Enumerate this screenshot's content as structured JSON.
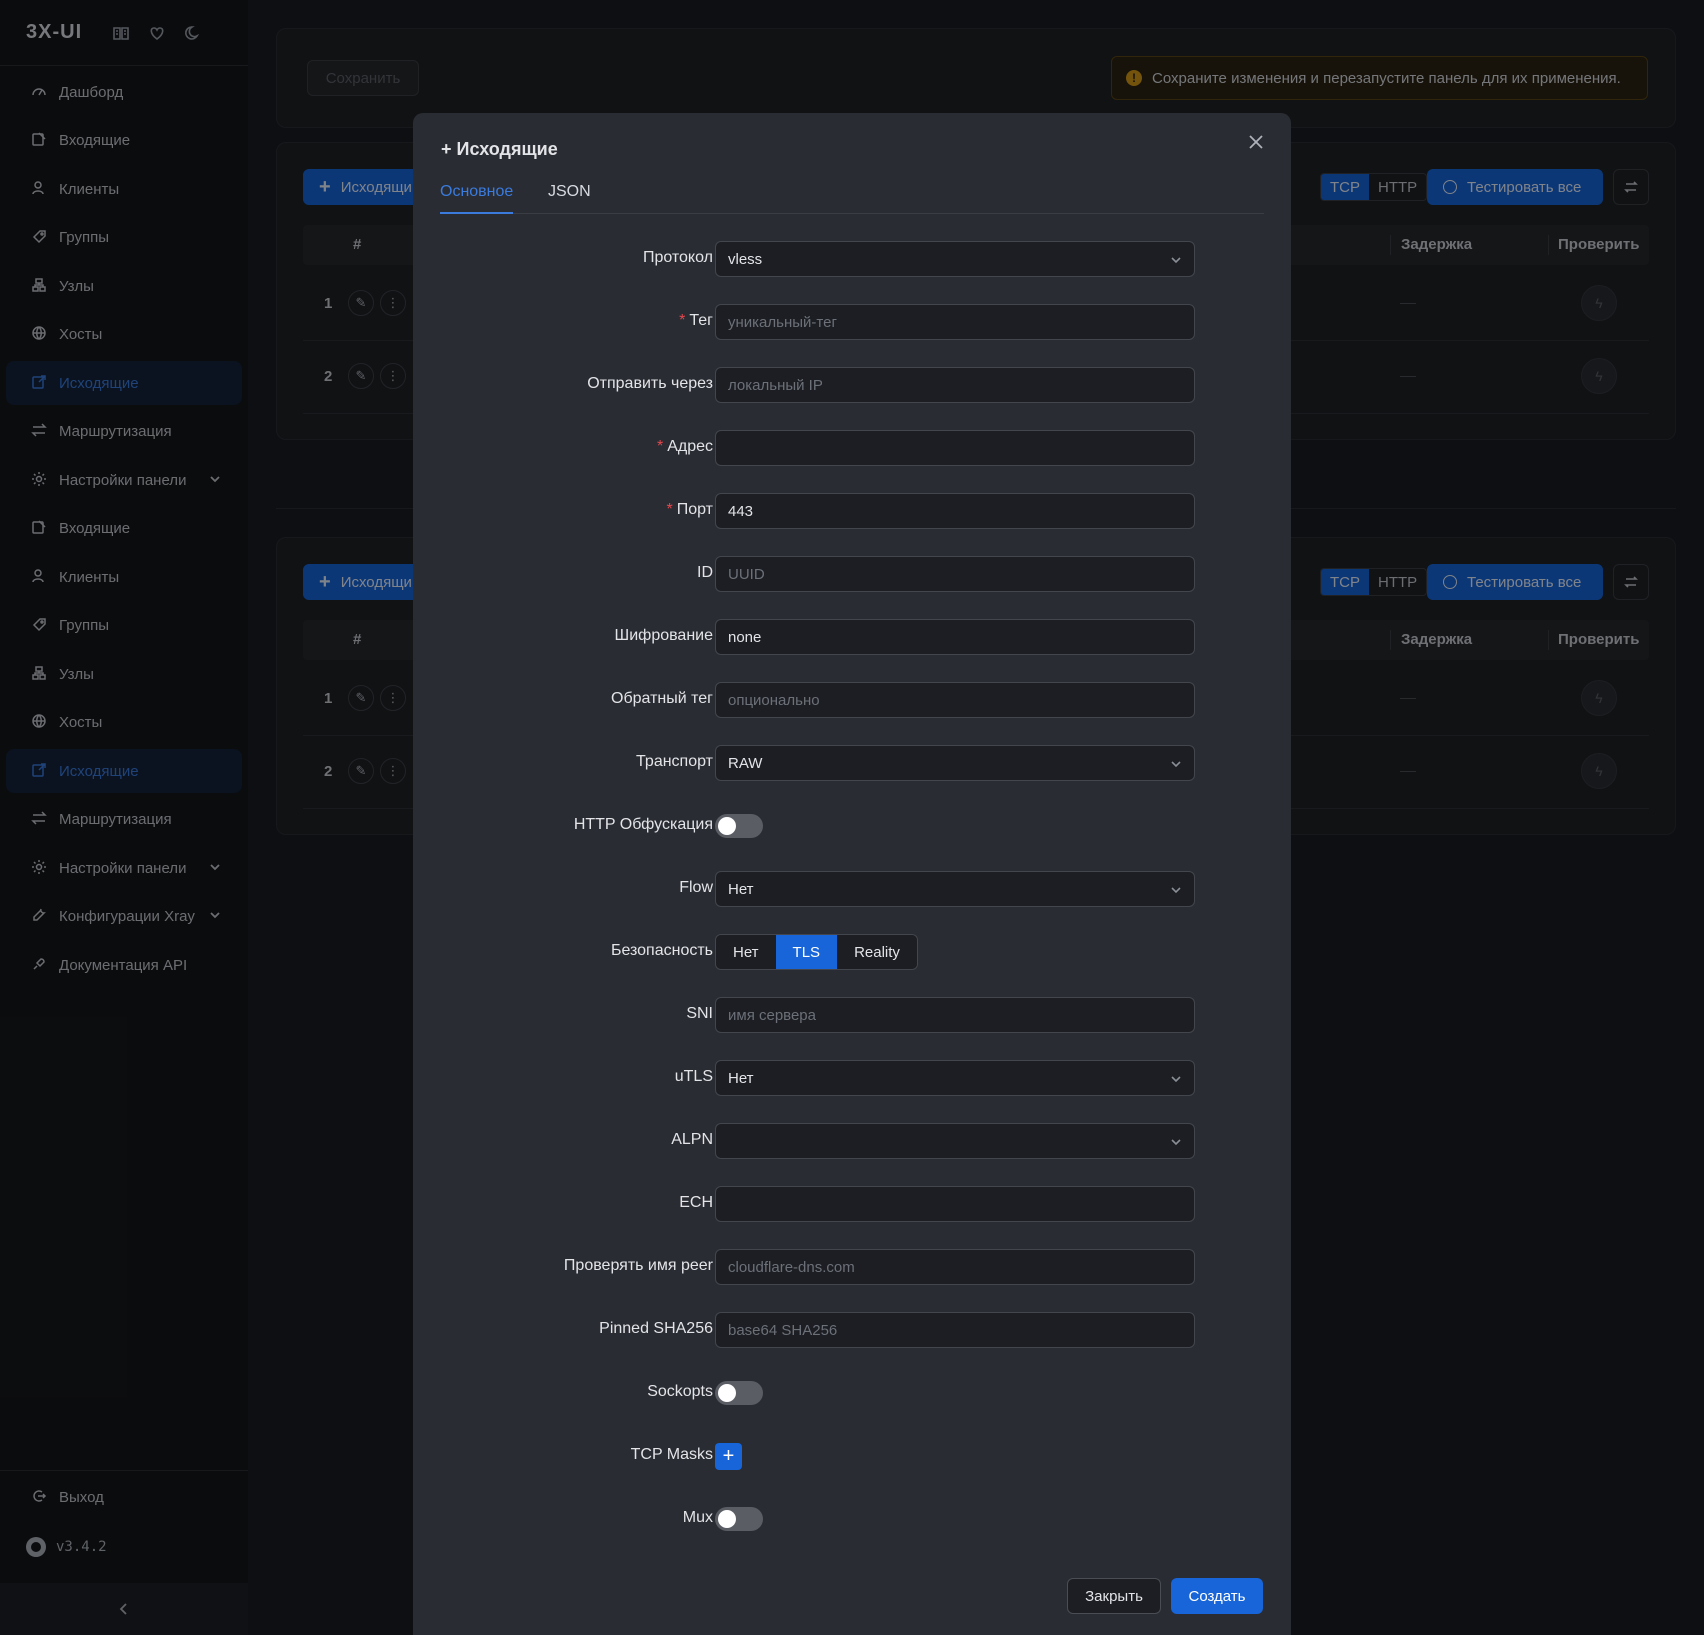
{
  "sidebar": {
    "brand": "3X-UI",
    "top_icons": [
      "book-icon",
      "heart-icon",
      "moon-icon"
    ],
    "items": [
      {
        "label": "Дашборд",
        "icon": "dashboard-icon"
      },
      {
        "label": "Входящие",
        "icon": "inbound-icon"
      },
      {
        "label": "Клиенты",
        "icon": "clients-icon"
      },
      {
        "label": "Группы",
        "icon": "groups-icon"
      },
      {
        "label": "Узлы",
        "icon": "nodes-icon"
      },
      {
        "label": "Хосты",
        "icon": "globe-icon"
      },
      {
        "label": "Исходящие",
        "icon": "outbound-icon",
        "active": true
      },
      {
        "label": "Маршрутизация",
        "icon": "routing-icon"
      },
      {
        "label": "Настройки панели",
        "icon": "settings-icon",
        "expandable": true
      },
      {
        "label": "Входящие",
        "icon": "inbound-icon"
      },
      {
        "label": "Клиенты",
        "icon": "clients-icon"
      },
      {
        "label": "Группы",
        "icon": "groups-icon"
      },
      {
        "label": "Узлы",
        "icon": "nodes-icon"
      },
      {
        "label": "Хосты",
        "icon": "globe-icon"
      },
      {
        "label": "Исходящие",
        "icon": "outbound-icon",
        "active": true
      },
      {
        "label": "Маршрутизация",
        "icon": "routing-icon"
      },
      {
        "label": "Настройки панели",
        "icon": "settings-icon",
        "expandable": true
      },
      {
        "label": "Конфигурации Xray",
        "icon": "tool-icon",
        "expandable": true
      },
      {
        "label": "Документация API",
        "icon": "api-icon"
      }
    ],
    "logout": "Выход",
    "version": "v3.4.2"
  },
  "background": {
    "save_label": "Сохранить",
    "alert_text": "Сохраните изменения и перезапустите панель для их применения.",
    "add_button": "Исходящи",
    "seg_tcp": "TCP",
    "seg_http": "HTTP",
    "test_all": "Тестировать все",
    "col_num": "#",
    "col_latency": "Задержка",
    "col_check": "Проверить",
    "rows": [
      "1",
      "2"
    ]
  },
  "modal": {
    "title": "+ Исходящие",
    "tabs": {
      "basic": "Основное",
      "json": "JSON"
    },
    "fields": {
      "protocol": {
        "label": "Протокол",
        "value": "vless"
      },
      "tag": {
        "label": "Тег",
        "placeholder": "уникальный-тег"
      },
      "send_through": {
        "label": "Отправить через",
        "placeholder": "локальный IP"
      },
      "address": {
        "label": "Адрес",
        "value": ""
      },
      "port": {
        "label": "Порт",
        "value": "443"
      },
      "id": {
        "label": "ID",
        "placeholder": "UUID"
      },
      "encryption": {
        "label": "Шифрование",
        "value": "none"
      },
      "reverse_tag": {
        "label": "Обратный тег",
        "placeholder": "опционально"
      },
      "transport": {
        "label": "Транспорт",
        "value": "RAW"
      },
      "http_obfs": {
        "label": "HTTP Обфускация",
        "on": false
      },
      "flow": {
        "label": "Flow",
        "value": "Нет"
      },
      "security": {
        "label": "Безопасность",
        "options": [
          "Нет",
          "TLS",
          "Reality"
        ],
        "selected": "TLS"
      },
      "sni": {
        "label": "SNI",
        "placeholder": "имя сервера"
      },
      "utls": {
        "label": "uTLS",
        "value": "Нет"
      },
      "alpn": {
        "label": "ALPN",
        "value": ""
      },
      "ech": {
        "label": "ECH",
        "value": ""
      },
      "verify_peer": {
        "label": "Проверять имя peer",
        "placeholder": "cloudflare-dns.com"
      },
      "pinned": {
        "label": "Pinned SHA256",
        "placeholder": "base64 SHA256"
      },
      "sockopts": {
        "label": "Sockopts",
        "on": false
      },
      "tcp_masks": {
        "label": "TCP Masks"
      },
      "mux": {
        "label": "Mux",
        "on": false
      }
    },
    "close_label": "Закрыть",
    "create_label": "Создать"
  }
}
